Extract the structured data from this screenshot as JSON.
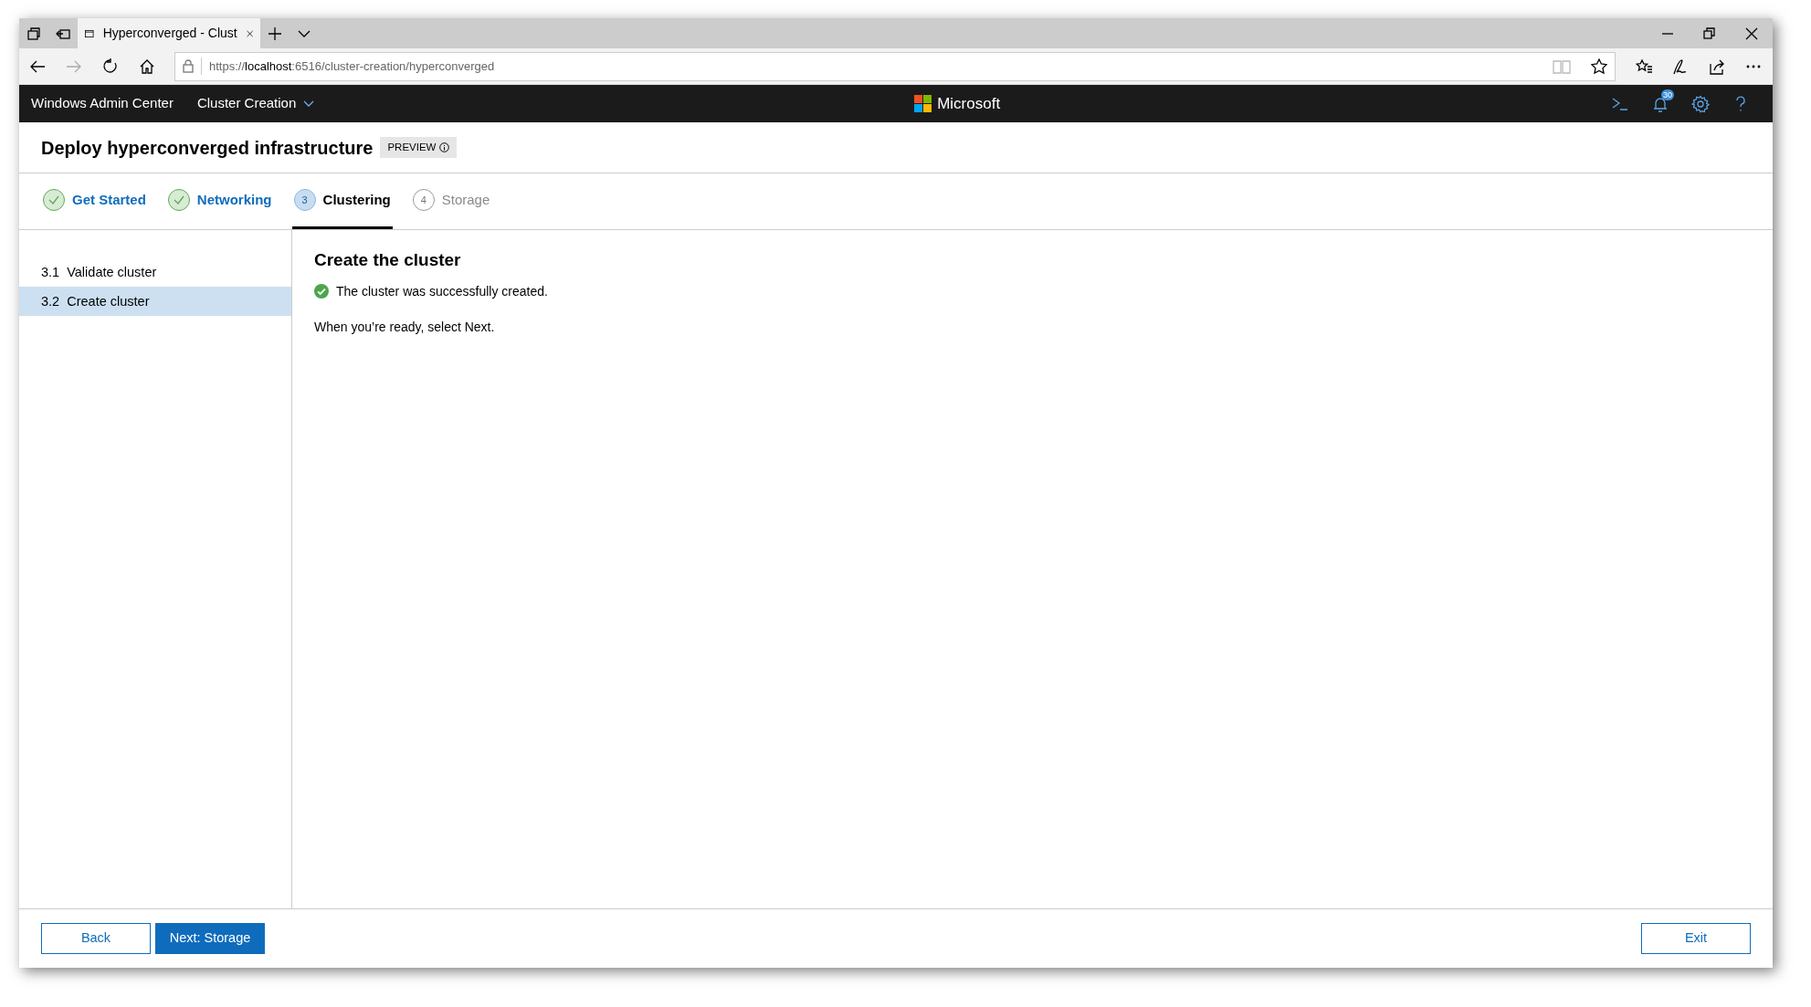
{
  "browser": {
    "tabs": [
      {
        "title": "Hyperconverged - Clust",
        "selected": true
      }
    ],
    "url": {
      "prefix": "https://",
      "host": "localhost",
      "rest": ":6516/cluster-creation/hyperconverged"
    }
  },
  "app_header": {
    "app_name": "Windows Admin Center",
    "context_menu": "Cluster Creation",
    "brand": "Microsoft",
    "notification_count": "30"
  },
  "page": {
    "title": "Deploy hyperconverged infrastructure",
    "badge": "PREVIEW"
  },
  "steps": [
    {
      "label": "Get Started",
      "completed": true,
      "selected": false
    },
    {
      "label": "Networking",
      "completed": true,
      "selected": false
    },
    {
      "number": "3",
      "label": "Clustering",
      "completed": false,
      "selected": true
    },
    {
      "number": "4",
      "label": "Storage",
      "completed": false,
      "selected": false
    }
  ],
  "substeps": [
    {
      "number": "3.1",
      "label": "Validate cluster",
      "selected": false
    },
    {
      "number": "3.2",
      "label": "Create cluster",
      "selected": true
    }
  ],
  "content": {
    "heading": "Create the cluster",
    "status_message": "The cluster was successfully created.",
    "instruction": "When you’re ready, select Next."
  },
  "footer": {
    "buttons": [
      {
        "label": "Back",
        "kind": "outline"
      },
      {
        "label": "Next: Storage",
        "kind": "primary"
      },
      {
        "label": "Exit",
        "kind": "outline-right"
      }
    ]
  }
}
